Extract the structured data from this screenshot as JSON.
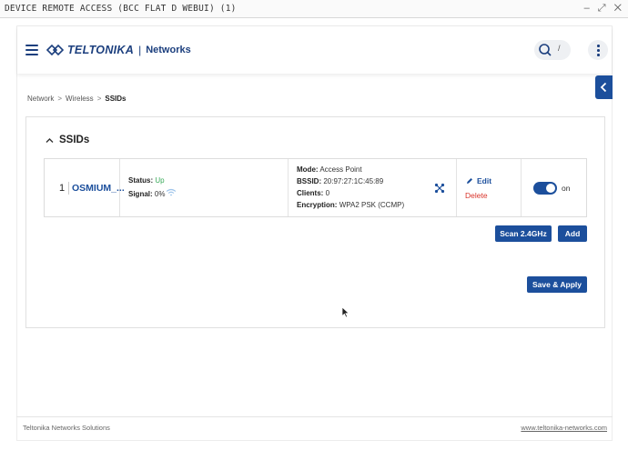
{
  "window": {
    "title": "DEVICE REMOTE ACCESS (BCC FLAT D WEBUI) (1)",
    "controls": "– ⤢ ✕"
  },
  "header": {
    "brand": "TELTONIKA",
    "separator": "|",
    "product": "Networks",
    "search_shortcut": "/"
  },
  "breadcrumb": {
    "items": [
      "Network",
      "Wireless",
      "SSIDs"
    ],
    "separator": ">"
  },
  "section": {
    "title": "SSIDs"
  },
  "ssid_rows": [
    {
      "index": "1",
      "name": "OSMIUM_...",
      "status_label": "Status:",
      "status_value": "Up",
      "signal_label": "Signal:",
      "signal_value": "0%",
      "mode_label": "Mode:",
      "mode_value": "Access Point",
      "bssid_label": "BSSID:",
      "bssid_value": "20:97:27:1C:45:89",
      "clients_label": "Clients:",
      "clients_value": "0",
      "encryption_label": "Encryption:",
      "encryption_value": "WPA2 PSK (CCMP)",
      "edit_label": "Edit",
      "delete_label": "Delete",
      "toggle_state": "on"
    }
  ],
  "buttons": {
    "scan": "Scan 2.4GHz",
    "add": "Add",
    "save": "Save & Apply"
  },
  "footer": {
    "left": "Teltonika Networks Solutions",
    "right": "www.teltonika-networks.com"
  },
  "colors": {
    "brand_blue": "#1c4f9c",
    "status_up": "#3aaa5a",
    "delete_red": "#d9342b"
  },
  "icons": [
    "hamburger-icon",
    "teltonika-logo-icon",
    "search-icon",
    "kebab-icon",
    "chevron-left-icon",
    "chevron-up-icon",
    "wifi-icon",
    "mesh-icon",
    "pencil-icon",
    "mouse-cursor-icon"
  ]
}
